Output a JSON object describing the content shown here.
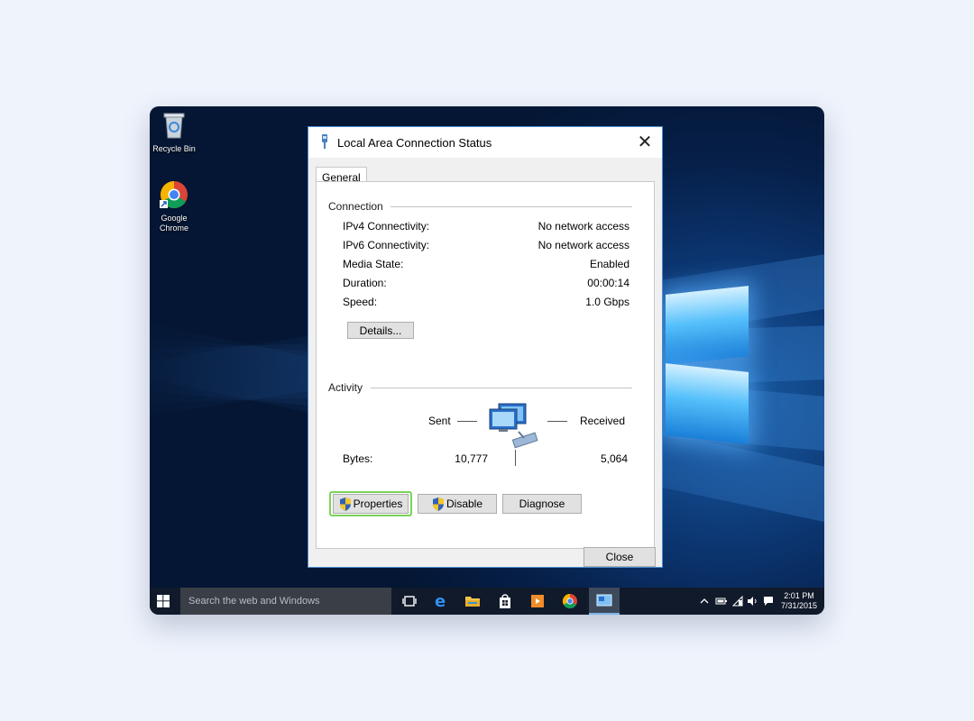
{
  "desktop": {
    "icons": [
      {
        "label": "Recycle Bin",
        "icon": "recycle-bin-icon"
      },
      {
        "label": "Google Chrome",
        "icon": "chrome-icon"
      }
    ]
  },
  "dialog": {
    "title": "Local Area Connection Status",
    "tab_general": "General",
    "connection": {
      "label": "Connection",
      "rows": [
        {
          "key": "IPv4 Connectivity:",
          "value": "No network access"
        },
        {
          "key": "IPv6 Connectivity:",
          "value": "No network access"
        },
        {
          "key": "Media State:",
          "value": "Enabled"
        },
        {
          "key": "Duration:",
          "value": "00:00:14"
        },
        {
          "key": "Speed:",
          "value": "1.0 Gbps"
        }
      ],
      "details_button": "Details..."
    },
    "activity": {
      "label": "Activity",
      "sent": "Sent",
      "received": "Received",
      "bytes_label": "Bytes:",
      "bytes_sent": "10,777",
      "bytes_received": "5,064"
    },
    "buttons": {
      "properties": "Properties",
      "disable": "Disable",
      "diagnose": "Diagnose",
      "close": "Close"
    },
    "highlight_color": "#7bd35a"
  },
  "taskbar": {
    "search_placeholder": "Search the web and Windows",
    "clock_time": "2:01 PM",
    "clock_date": "7/31/2015"
  },
  "colors": {
    "dialog_border": "#4a8ed1",
    "desktop_accent": "#55c0fb"
  }
}
